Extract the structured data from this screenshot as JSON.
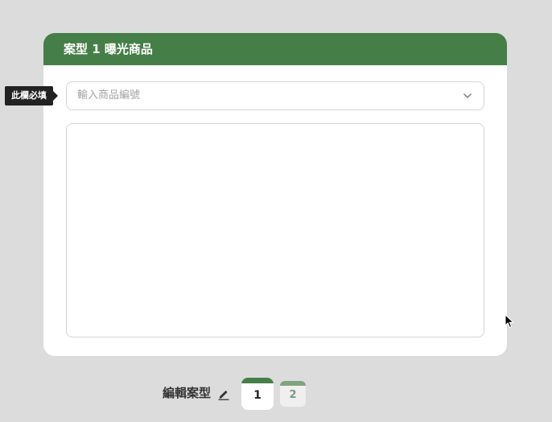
{
  "card": {
    "title": "案型 1 曝光商品",
    "select": {
      "placeholder": "輸入商品編號"
    },
    "required_tag": "此欄必填"
  },
  "footer": {
    "edit_label": "編輯案型",
    "tabs": [
      {
        "label": "1",
        "active": true
      },
      {
        "label": "2",
        "active": false
      }
    ]
  },
  "colors": {
    "brand_green": "#457f47",
    "background": "#dcdcdc"
  },
  "icons": {
    "select_chevron": "chevron-down-icon",
    "edit": "pencil-icon",
    "cursor": "mouse-pointer-icon"
  }
}
